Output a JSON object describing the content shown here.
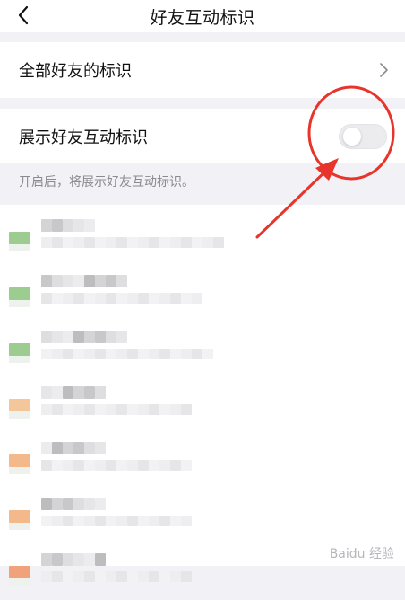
{
  "header": {
    "back_icon": "chevron-left-icon",
    "title": "好友互动标识"
  },
  "settings": {
    "all_friends_label": "全部好友的标识",
    "all_friends_icon": "chevron-right-icon",
    "show_badges_label": "展示好友互动标识",
    "show_badges_toggle_on": false,
    "show_badges_hint": "开启后，将展示好友互动标识。"
  },
  "friend_list": {
    "blurred": true,
    "rows": [
      {
        "avatar_color": "#9ccc8f"
      },
      {
        "avatar_color": "#9ccc8f"
      },
      {
        "avatar_color": "#9ccc8f"
      },
      {
        "avatar_color": "#f3c79a"
      },
      {
        "avatar_color": "#f3b98a"
      },
      {
        "avatar_color": "#f3b98a"
      },
      {
        "avatar_color": "#f0a27a"
      }
    ]
  },
  "annotation": {
    "color": "#e8352b",
    "type": "circle-and-arrow"
  },
  "watermark": {
    "text": "Baidu 经验"
  },
  "colors": {
    "background": "#f2f2f6",
    "toggle_off": "#ececef",
    "hint_text": "#8a8a8f"
  }
}
